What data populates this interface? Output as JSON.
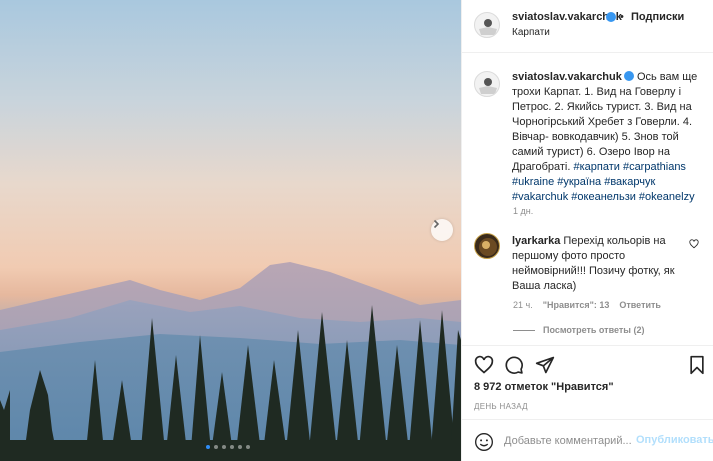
{
  "header": {
    "username": "sviatoslav.vakarchuk",
    "separator": "•",
    "follow_label": "Подписки",
    "location": "Карпати"
  },
  "caption": {
    "username": "sviatoslav.vakarchuk",
    "text": "Ось вам ще трохи Карпат. 1. Вид на Говерлу і Петрос. 2. Якийсь турист. 3. Вид на Чорногірський Хребет з Говерли. 4. Вівчар- вовкодавчик) 5. Знов той самий турист) 6. Озеро Івор на Драгобраті.",
    "hashtags": "#карпати #carpathians #ukraine #україна #вакарчук #vakarchuk #океанельзи #okeanelzy",
    "time": "1 дн."
  },
  "comment": {
    "username": "lyarkarka",
    "text": "Перехід кольорів на першому фото просто неймовірний!!! Позичу фотку, як Ваша ласка)",
    "time": "21 ч.",
    "likes_label": "\"Нравится\": 13",
    "reply_label": "Ответить",
    "view_replies": "Посмотреть ответы (2)"
  },
  "post": {
    "likes_text": "8 972 отметок \"Нравится\"",
    "time_ago": "ДЕНЬ НАЗАД"
  },
  "add_comment": {
    "placeholder": "Добавьте комментарий...",
    "post_label": "Опубликовать"
  },
  "carousel": {
    "count": 6,
    "active_index": 0
  },
  "colors": {
    "accent": "#3897f0",
    "link": "#00376b",
    "muted": "#8e8e8e"
  },
  "icons": [
    "chevron-right-icon",
    "verified-icon",
    "heart-icon",
    "comment-icon",
    "share-icon",
    "bookmark-icon",
    "emoji-icon"
  ]
}
